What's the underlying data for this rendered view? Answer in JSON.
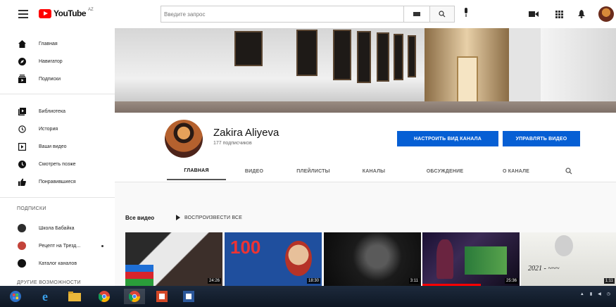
{
  "header": {
    "logo_text": "YouTube",
    "logo_country": "AZ",
    "search_placeholder": "Введите запрос"
  },
  "sidebar": {
    "items": [
      {
        "label": "Главная",
        "icon": "home-icon"
      },
      {
        "label": "Навигатор",
        "icon": "compass-icon"
      },
      {
        "label": "Подписки",
        "icon": "subscriptions-icon"
      },
      {
        "label": "Библиотека",
        "icon": "library-icon"
      },
      {
        "label": "История",
        "icon": "history-icon"
      },
      {
        "label": "Ваши видео",
        "icon": "your-videos-icon"
      },
      {
        "label": "Смотреть позже",
        "icon": "watch-later-icon"
      },
      {
        "label": "Понравившиеся",
        "icon": "thumbs-up-icon"
      }
    ],
    "subscriptions_heading": "ПОДПИСКИ",
    "subscriptions": [
      {
        "label": "Школа Бабайка",
        "color": "#2d2d2d"
      },
      {
        "label": "Рецепт на Трезд...",
        "color": "#c3433a"
      },
      {
        "label": "Каталог каналов",
        "color": "#111111"
      }
    ],
    "more_heading": "ДРУГИЕ ВОЗМОЖНОСТИ"
  },
  "channel": {
    "name": "Zakira Aliyeva",
    "subscribers": "177 подписчиков",
    "customize_button": "НАСТРОИТЬ ВИД КАНАЛА",
    "manage_button": "УПРАВЛЯТЬ ВИДЕО"
  },
  "tabs": [
    {
      "label": "ГЛАВНАЯ",
      "active": true
    },
    {
      "label": "ВИДЕО",
      "active": false
    },
    {
      "label": "ПЛЕЙЛИСТЫ",
      "active": false
    },
    {
      "label": "КАНАЛЫ",
      "active": false
    },
    {
      "label": "ОБСУЖДЕНИЕ",
      "active": false
    },
    {
      "label": "О КАНАЛЕ",
      "active": false
    }
  ],
  "section": {
    "title": "Все видео",
    "play_all": "ВОСПРОИЗВЕСТИ ВСЕ"
  },
  "videos": [
    {
      "duration": "24:26",
      "watched_fraction": 0.0
    },
    {
      "duration": "18:30",
      "watched_fraction": 0.0
    },
    {
      "duration": "3:11",
      "watched_fraction": 0.0
    },
    {
      "duration": "25:36",
      "watched_fraction": 0.6
    },
    {
      "duration": "1:11",
      "watched_fraction": 0.0
    }
  ],
  "colors": {
    "accent_blue": "#065fd4",
    "youtube_red": "#ff0000"
  }
}
